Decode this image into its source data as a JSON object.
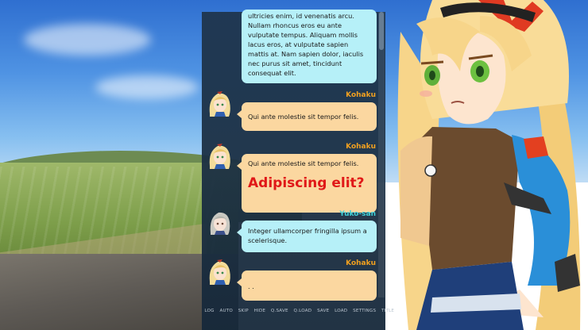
{
  "log": {
    "entries": [
      {
        "speaker": "",
        "speaker_color": "",
        "bubble": "cyan",
        "text": "ultricies enim, id venenatis arcu. Nullam rhoncus eros eu ante vulputate tempus. Aliquam mollis lacus eros, at vulputate sapien mattis at. Nam sapien dolor, iaculis nec purus sit amet, tincidunt consequat elit.",
        "avatar": "none",
        "emphasis": ""
      },
      {
        "speaker": "Kohaku",
        "speaker_color": "#f0a020",
        "bubble": "orange",
        "text": "Qui ante molestie sit tempor felis.",
        "avatar": "kohaku-avatar",
        "emphasis": ""
      },
      {
        "speaker": "Kohaku",
        "speaker_color": "#f0a020",
        "bubble": "orange",
        "text": "Qui ante molestie sit tempor felis.",
        "avatar": "kohaku-avatar",
        "emphasis": "Adipiscing elit?"
      },
      {
        "speaker": "Yuko-san",
        "speaker_color": "#40d0d8",
        "bubble": "cyan",
        "text": "Integer ullamcorper fringilla ipsum a scelerisque.",
        "avatar": "yuko-avatar",
        "emphasis": ""
      },
      {
        "speaker": "Kohaku",
        "speaker_color": "#f0a020",
        "bubble": "orange",
        "text": ". .",
        "avatar": "kohaku-avatar",
        "emphasis": ""
      }
    ]
  },
  "menu": [
    "LOG",
    "AUTO",
    "SKIP",
    "HIDE",
    "Q.SAVE",
    "Q.LOAD",
    "SAVE",
    "LOAD",
    "SETTINGS",
    "TITLE"
  ],
  "colors": {
    "orange_bubble": "#fbd7a0",
    "cyan_bubble": "#b6f0f8",
    "emphasis_red": "#e01818"
  }
}
